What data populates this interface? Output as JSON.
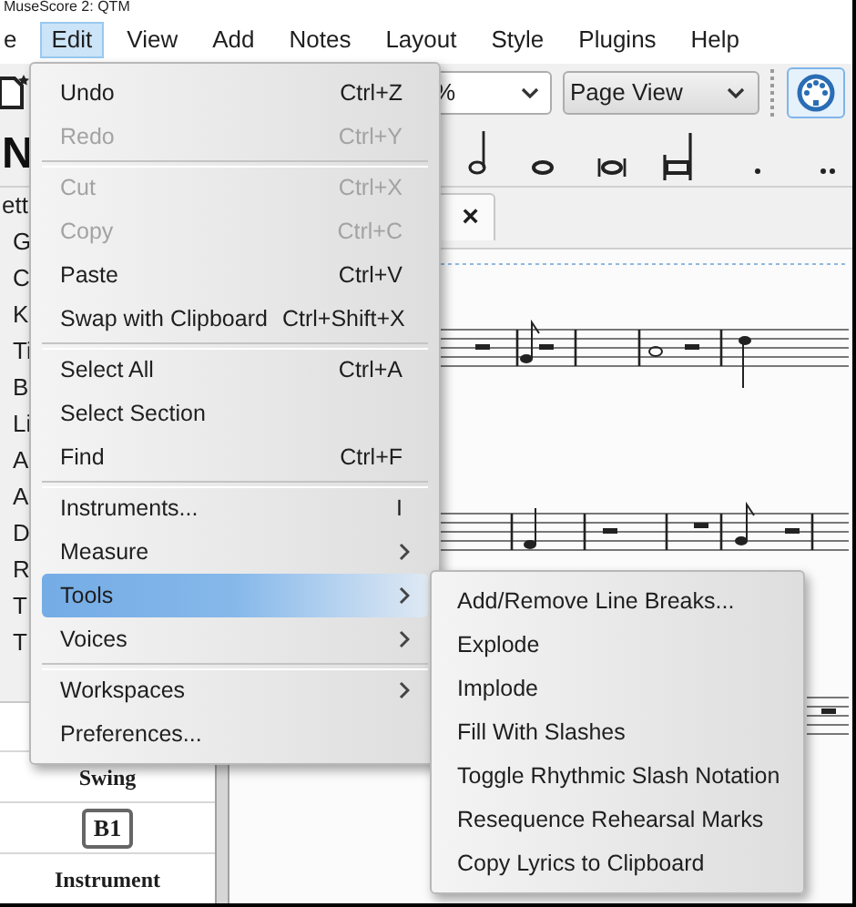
{
  "window": {
    "title": "MuseScore 2: QTM"
  },
  "menu_bar": [
    {
      "label": "e",
      "selected": false
    },
    {
      "label": "Edit",
      "selected": true
    },
    {
      "label": "View",
      "selected": false
    },
    {
      "label": "Add",
      "selected": false
    },
    {
      "label": "Notes",
      "selected": false
    },
    {
      "label": "Layout",
      "selected": false
    },
    {
      "label": "Style",
      "selected": false
    },
    {
      "label": "Plugins",
      "selected": false
    },
    {
      "label": "Help",
      "selected": false
    }
  ],
  "toolbar": {
    "zoom_value": "%",
    "view_mode": "Page View",
    "note_input_glyph": "N"
  },
  "palette": {
    "title": "ett",
    "items": [
      "G",
      "C",
      "K",
      "Ti",
      "B",
      "Li",
      "A",
      "A",
      "D",
      "R",
      "T",
      "T"
    ]
  },
  "palette_list": [
    {
      "kind": "text",
      "label": "Swing"
    },
    {
      "kind": "boxed",
      "label": "B1"
    },
    {
      "kind": "text",
      "label": "Instrument"
    }
  ],
  "score_tab": {
    "close": "×"
  },
  "edit_menu": [
    {
      "kind": "item",
      "label": "Undo",
      "shortcut": "Ctrl+Z",
      "disabled": false
    },
    {
      "kind": "item",
      "label": "Redo",
      "shortcut": "Ctrl+Y",
      "disabled": true
    },
    {
      "kind": "separator"
    },
    {
      "kind": "item",
      "label": "Cut",
      "shortcut": "Ctrl+X",
      "disabled": true
    },
    {
      "kind": "item",
      "label": "Copy",
      "shortcut": "Ctrl+C",
      "disabled": true
    },
    {
      "kind": "item",
      "label": "Paste",
      "shortcut": "Ctrl+V",
      "disabled": false
    },
    {
      "kind": "item",
      "label": "Swap with Clipboard",
      "shortcut": "Ctrl+Shift+X",
      "disabled": false
    },
    {
      "kind": "separator"
    },
    {
      "kind": "item",
      "label": "Select All",
      "shortcut": "Ctrl+A",
      "disabled": false
    },
    {
      "kind": "item",
      "label": "Select Section",
      "disabled": false
    },
    {
      "kind": "item",
      "label": "Find",
      "shortcut": "Ctrl+F",
      "disabled": false
    },
    {
      "kind": "separator"
    },
    {
      "kind": "item",
      "label": "Instruments...",
      "shortcut": "I",
      "disabled": false
    },
    {
      "kind": "submenu",
      "label": "Measure",
      "selected": false
    },
    {
      "kind": "submenu",
      "label": "Tools",
      "selected": true
    },
    {
      "kind": "submenu",
      "label": "Voices",
      "selected": false
    },
    {
      "kind": "separator"
    },
    {
      "kind": "submenu",
      "label": "Workspaces",
      "selected": false
    },
    {
      "kind": "item",
      "label": "Preferences...",
      "disabled": false
    }
  ],
  "tools_submenu": [
    "Add/Remove Line Breaks...",
    "Explode",
    "Implode",
    "Fill With Slashes",
    "Toggle Rhythmic Slash Notation",
    "Resequence Rehearsal Marks",
    "Copy Lyrics to Clipboard"
  ]
}
